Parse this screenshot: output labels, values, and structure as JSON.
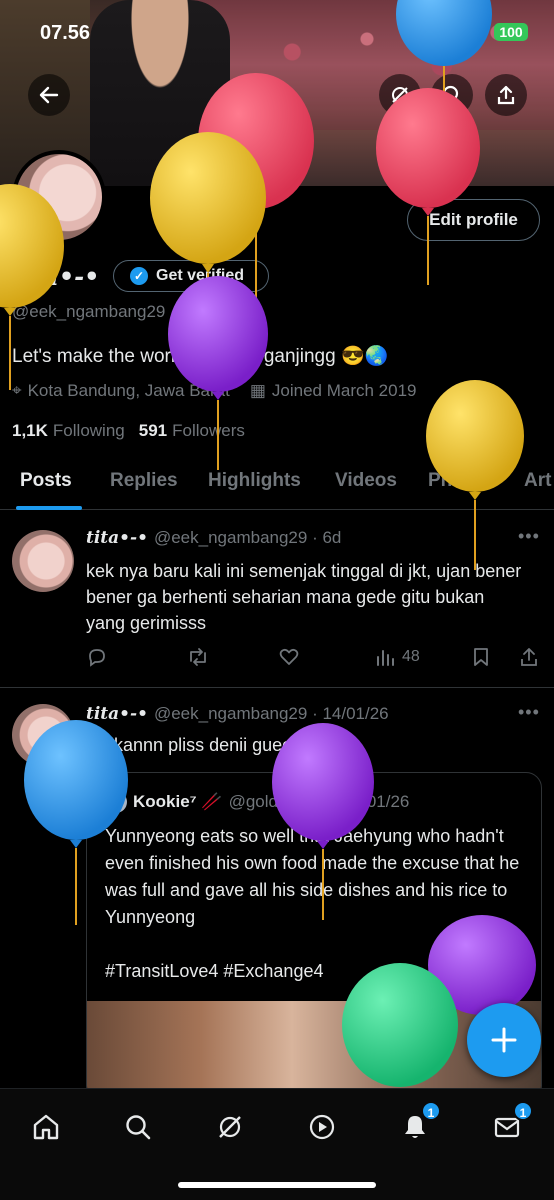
{
  "status": {
    "time": "07.56",
    "battery": "100"
  },
  "profile": {
    "name": "tita•-•",
    "get_verified": "Get verified",
    "handle": "@eek_ngambang29",
    "bio": "Let's make the world gonjang ganjingg 😎🌏",
    "location": "Kota Bandung, Jawa Barat",
    "joined": "Joined March 2019",
    "following_count": "1,1K",
    "following_label": "Following",
    "followers_count": "591",
    "followers_label": "Followers",
    "edit_profile": "Edit profile"
  },
  "tabs": [
    "Posts",
    "Replies",
    "Highlights",
    "Videos",
    "Photos",
    "Art"
  ],
  "tweets": [
    {
      "name": "tita•-•",
      "meta": "@eek_ngambang29 · 6d",
      "text": "kek nya baru kali ini semenjak tinggal di jkt, ujan bener bener ga berhenti seharian mana gede gitu bukan yang gerimisss",
      "views": "48"
    },
    {
      "name": "tita•-•",
      "meta": "@eek_ngambang29 · 14/01/26",
      "text": "bailkannn pliss denii gueeee",
      "quote": {
        "name": "Kookie⁷ 🥢",
        "meta": "@goldenjk7_ · 14/01/26",
        "text": "Yunnyeong eats so well that Jaehyung who hadn't even finished his own food made the excuse that he was full and gave all his side dishes and his rice to Yunnyeong",
        "tags": "#TransitLove4 #Exchange4"
      }
    }
  ],
  "nav": {
    "notifications_badge": "1",
    "messages_badge": "1"
  },
  "colors": {
    "accent": "#1d9bf0",
    "background": "#000000",
    "muted": "#71767b"
  }
}
